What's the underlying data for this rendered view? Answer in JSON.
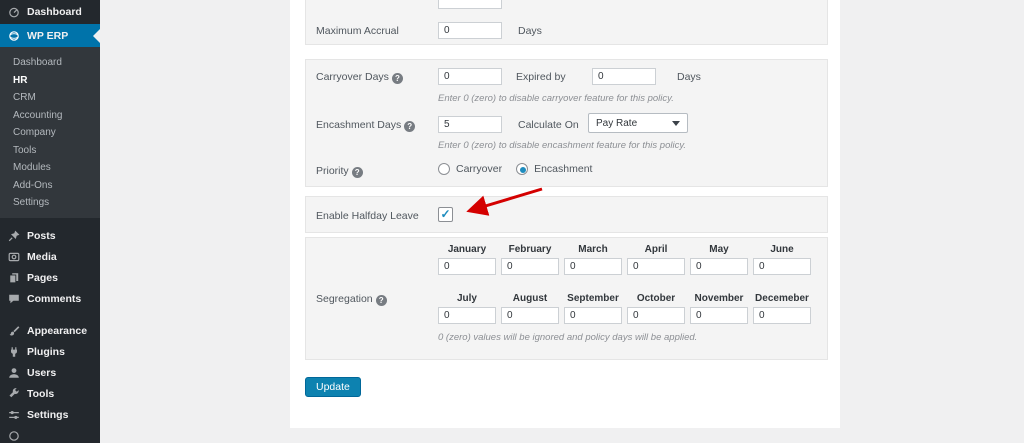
{
  "sidebar": {
    "dashboard_label": "Dashboard",
    "wp_erp_label": "WP ERP",
    "erp_submenu": [
      "Dashboard",
      "HR",
      "CRM",
      "Accounting",
      "Company",
      "Tools",
      "Modules",
      "Add-Ons",
      "Settings"
    ],
    "erp_submenu_current": "HR",
    "menu_group1": [
      "Posts",
      "Media",
      "Pages",
      "Comments"
    ],
    "menu_group2": [
      "Appearance",
      "Plugins",
      "Users",
      "Tools",
      "Settings"
    ]
  },
  "form": {
    "help_glyph": "?",
    "maximum_accrual": {
      "label": "Maximum Accrual",
      "value": "0",
      "unit": "Days"
    },
    "carryover": {
      "label": "Carryover Days",
      "value": "0",
      "expired_by_label": "Expired by",
      "expired_value": "0",
      "unit": "Days",
      "help": "Enter 0 (zero) to disable carryover feature for this policy."
    },
    "encashment": {
      "label": "Encashment Days",
      "value": "5",
      "calculate_on_label": "Calculate On",
      "calculate_on_value": "Pay Rate",
      "help": "Enter 0 (zero) to disable encashment feature for this policy."
    },
    "priority": {
      "label": "Priority",
      "option1": "Carryover",
      "option2": "Encashment",
      "selected": "Encashment"
    },
    "halfday": {
      "label": "Enable Halfday Leave",
      "checked": true,
      "check_glyph": "✓"
    },
    "segregation": {
      "label": "Segregation",
      "months": [
        {
          "name": "January",
          "value": "0"
        },
        {
          "name": "February",
          "value": "0"
        },
        {
          "name": "March",
          "value": "0"
        },
        {
          "name": "April",
          "value": "0"
        },
        {
          "name": "May",
          "value": "0"
        },
        {
          "name": "June",
          "value": "0"
        },
        {
          "name": "July",
          "value": "0"
        },
        {
          "name": "August",
          "value": "0"
        },
        {
          "name": "September",
          "value": "0"
        },
        {
          "name": "October",
          "value": "0"
        },
        {
          "name": "November",
          "value": "0"
        },
        {
          "name": "Decemeber",
          "value": "0"
        }
      ],
      "help": "0 (zero) values will be ignored and policy days will be applied."
    },
    "update_button": "Update"
  },
  "colors": {
    "menu_highlight": "#0073aa",
    "button_blue": "#0d82b0",
    "check_blue": "#1e8cbe",
    "arrow_red": "#d40000"
  }
}
